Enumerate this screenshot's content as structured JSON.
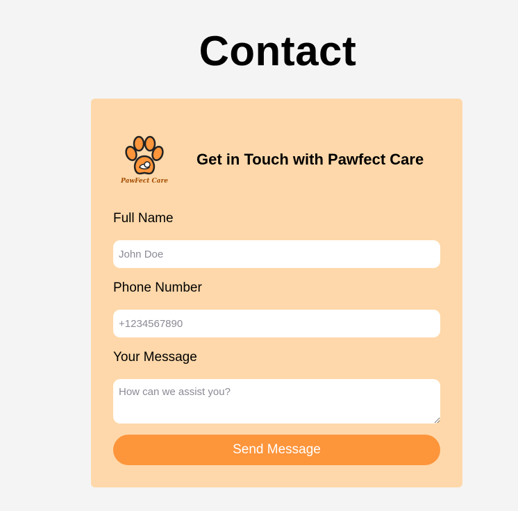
{
  "page": {
    "title": "Contact"
  },
  "card": {
    "heading": "Get in Touch with Pawfect Care",
    "logo_text": "PawFect Care",
    "logo_icon": "paw-print-icon"
  },
  "form": {
    "name": {
      "label": "Full Name",
      "placeholder": "John Doe",
      "value": ""
    },
    "phone": {
      "label": "Phone Number",
      "placeholder": "+1234567890",
      "value": ""
    },
    "message": {
      "label": "Your Message",
      "placeholder": "How can we assist you?",
      "value": ""
    },
    "submit_label": "Send Message"
  },
  "colors": {
    "background": "#f4f4f4",
    "card": "#fed8aa",
    "accent": "#fd953b",
    "input_background": "#ffffff"
  }
}
